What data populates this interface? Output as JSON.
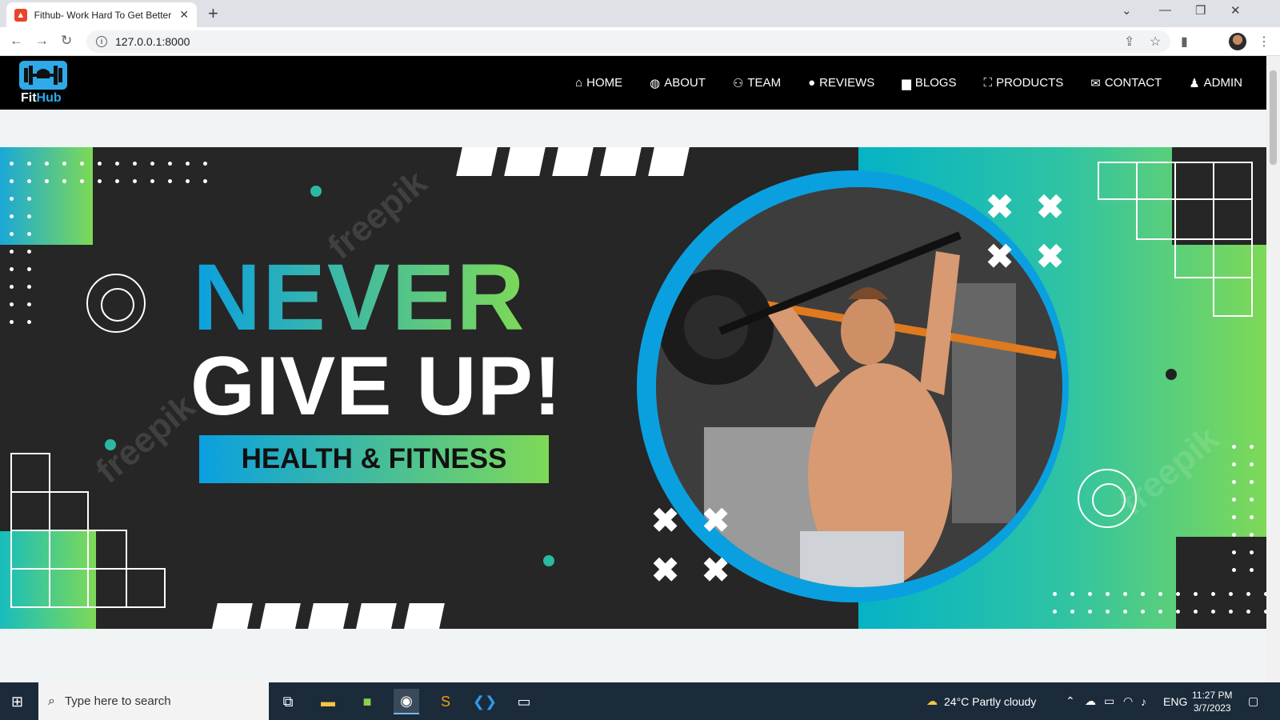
{
  "browser": {
    "tab_title": "Fithub- Work Hard To Get Better",
    "url": "127.0.0.1:8000"
  },
  "site": {
    "logo_text_a": "Fit",
    "logo_text_b": "Hub",
    "menu": [
      {
        "label": "HOME",
        "icon": "home-icon"
      },
      {
        "label": "ABOUT",
        "icon": "globe-icon"
      },
      {
        "label": "TEAM",
        "icon": "team-icon"
      },
      {
        "label": "REVIEWS",
        "icon": "comment-icon"
      },
      {
        "label": "BLOGS",
        "icon": "blog-icon"
      },
      {
        "label": "PRODUCTS",
        "icon": "basket-icon"
      },
      {
        "label": "CONTACT",
        "icon": "envelope-icon"
      },
      {
        "label": "ADMIN",
        "icon": "user-icon"
      }
    ]
  },
  "hero": {
    "line1": "NEVER",
    "line2": "GIVE UP!",
    "tagline": "HEALTH & FITNESS",
    "watermark": "freepik"
  },
  "taskbar": {
    "search_placeholder": "Type here to search",
    "weather": "24°C  Partly cloudy",
    "lang": "ENG",
    "time": "11:27 PM",
    "date": "3/7/2023"
  },
  "colors": {
    "accent_blue": "#0aa0e0",
    "accent_green": "#7ed957",
    "header_bg": "#000000",
    "banner_bg": "#262626"
  }
}
